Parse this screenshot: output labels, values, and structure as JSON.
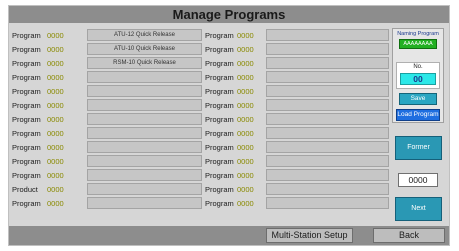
{
  "title": "Manage Programs",
  "left_rows": [
    {
      "label": "Program",
      "number": "0000",
      "name": "ATU-12 Quick Release"
    },
    {
      "label": "Program",
      "number": "0000",
      "name": "ATU-10 Quick Release"
    },
    {
      "label": "Program",
      "number": "0000",
      "name": "RSM-10 Quick Release"
    },
    {
      "label": "Program",
      "number": "0000",
      "name": ""
    },
    {
      "label": "Program",
      "number": "0000",
      "name": ""
    },
    {
      "label": "Program",
      "number": "0000",
      "name": ""
    },
    {
      "label": "Program",
      "number": "0000",
      "name": ""
    },
    {
      "label": "Program",
      "number": "0000",
      "name": ""
    },
    {
      "label": "Program",
      "number": "0000",
      "name": ""
    },
    {
      "label": "Program",
      "number": "0000",
      "name": ""
    },
    {
      "label": "Program",
      "number": "0000",
      "name": ""
    },
    {
      "label": "Product",
      "number": "0000",
      "name": ""
    },
    {
      "label": "Program",
      "number": "0000",
      "name": ""
    }
  ],
  "right_rows": [
    {
      "label": "Program",
      "number": "0000",
      "name": ""
    },
    {
      "label": "Program",
      "number": "0000",
      "name": ""
    },
    {
      "label": "Program",
      "number": "0000",
      "name": ""
    },
    {
      "label": "Program",
      "number": "0000",
      "name": ""
    },
    {
      "label": "Program",
      "number": "0000",
      "name": ""
    },
    {
      "label": "Program",
      "number": "0000",
      "name": ""
    },
    {
      "label": "Program",
      "number": "0000",
      "name": ""
    },
    {
      "label": "Program",
      "number": "0000",
      "name": ""
    },
    {
      "label": "Program",
      "number": "0000",
      "name": ""
    },
    {
      "label": "Program",
      "number": "0000",
      "name": ""
    },
    {
      "label": "Program",
      "number": "0000",
      "name": ""
    },
    {
      "label": "Program",
      "number": "0000",
      "name": ""
    },
    {
      "label": "Program",
      "number": "0000",
      "name": ""
    }
  ],
  "side": {
    "naming_label": "Naming Program",
    "naming_value": "AAAAAAAA",
    "no_label": "No.",
    "no_value": "00",
    "save_label": "Save",
    "load_label": "Load Program",
    "former_label": "Former",
    "page_value": "0000",
    "next_label": "Next"
  },
  "bottom": {
    "multi_station_label": "Multi-Station Setup",
    "back_label": "Back"
  },
  "colors": {
    "naming_value_bg": "#22b022",
    "no_value_bg": "#2be8e8",
    "save_bg": "#2aa6c2",
    "load_bg": "#1e6ee0",
    "nav_bg": "#2a98b4",
    "number_text": "#8a8a00"
  }
}
